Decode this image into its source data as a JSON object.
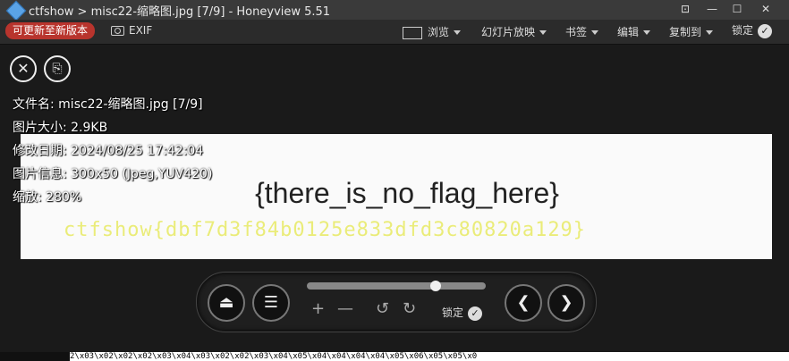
{
  "window": {
    "title": "ctfshow > misc22-缩略图.jpg [7/9] - Honeyview 5.51",
    "buttons": {
      "pin": "⊡",
      "minimize": "—",
      "maximize": "☐",
      "close": "✕"
    }
  },
  "toolbar": {
    "update_label": "可更新至新版本",
    "exif_label": "EXIF",
    "menus": [
      "浏览",
      "幻灯片放映",
      "书签",
      "编辑",
      "复制到"
    ],
    "lock_label": "锁定"
  },
  "info": {
    "filename": "文件名: misc22-缩略图.jpg [7/9]",
    "filesize": "图片大小: 2.9KB",
    "modified": "修改日期: 2024/08/25 17:42:04",
    "imageinfo": "图片信息: 300x50 (Jpeg,YUV420)",
    "zoom": "缩放: 280%"
  },
  "image": {
    "main_text": "{there_is_no_flag_here}",
    "hidden_text": "ctfshow{dbf7d3f84b0125e833dfd3c80820a129}"
  },
  "panel": {
    "lock_label": "锁定",
    "plus": "+",
    "minus": "—",
    "rotate_left": "↺",
    "rotate_right": "↻"
  },
  "statusbar": {
    "text": "2\\x03\\x02\\x02\\x02\\x03\\x04\\x03\\x02\\x02\\x03\\x04\\x05\\x04\\x04\\x04\\x04\\x05\\x06\\x05\\x05\\x0"
  },
  "colors": {
    "update_button": "#b8342d",
    "hidden_text": "#e8ea63",
    "accent_icon": "#5aa3e6"
  }
}
